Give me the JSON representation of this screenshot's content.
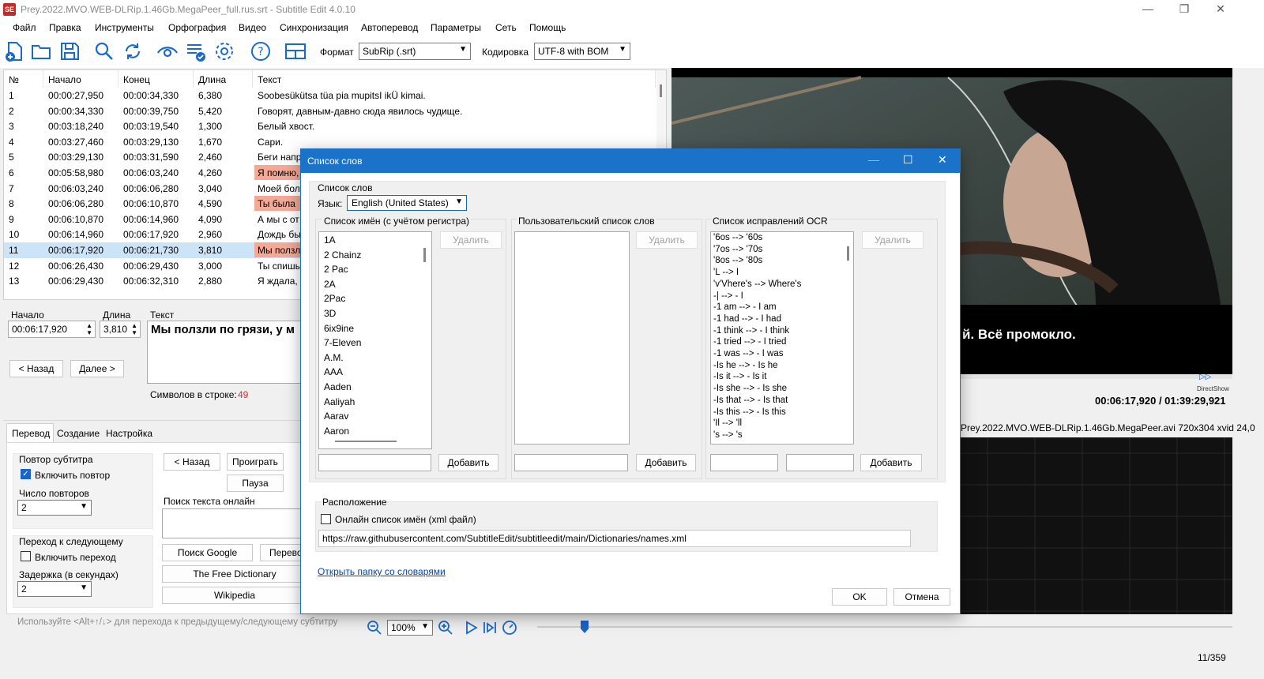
{
  "window": {
    "title": "Prey.2022.MVO.WEB-DLRip.1.46Gb.MegaPeer_full.rus.srt - Subtitle Edit 4.0.10",
    "app_icon": "SE"
  },
  "menu": [
    "Файл",
    "Правка",
    "Инструменты",
    "Орфография",
    "Видео",
    "Синхронизация",
    "Автоперевод",
    "Параметры",
    "Сеть",
    "Помощь"
  ],
  "toolbar": {
    "format_label": "Формат",
    "format_value": "SubRip (.srt)",
    "encoding_label": "Кодировка",
    "encoding_value": "UTF-8 with BOM",
    "icons": [
      "new-file-icon",
      "open-folder-icon",
      "save-icon",
      "find-icon",
      "replace-icon",
      "visual-sync-icon",
      "spell-check-icon",
      "settings-icon",
      "help-icon",
      "layout-icon"
    ]
  },
  "grid": {
    "headers": [
      "№",
      "Начало",
      "Конец",
      "Длина",
      "Текст"
    ],
    "rows": [
      {
        "n": "1",
        "start": "00:00:27,950",
        "end": "00:00:34,330",
        "dur": "6,380",
        "text": "Soobesükütsa tüa pia mupitsI ikÜ kimai."
      },
      {
        "n": "2",
        "start": "00:00:34,330",
        "end": "00:00:39,750",
        "dur": "5,420",
        "text": "Говорят, давным-давно сюда явилось чудище."
      },
      {
        "n": "3",
        "start": "00:03:18,240",
        "end": "00:03:19,540",
        "dur": "1,300",
        "text": "Белый хвост."
      },
      {
        "n": "4",
        "start": "00:03:27,460",
        "end": "00:03:29,130",
        "dur": "1,670",
        "text": "Сари."
      },
      {
        "n": "5",
        "start": "00:03:29,130",
        "end": "00:03:31,590",
        "dur": "2,460",
        "text": "Беги напр"
      },
      {
        "n": "6",
        "start": "00:05:58,980",
        "end": "00:06:03,240",
        "dur": "4,260",
        "text": "Я помню,"
      },
      {
        "n": "7",
        "start": "00:06:03,240",
        "end": "00:06:06,280",
        "dur": "3,040",
        "text": "Моей бол"
      },
      {
        "n": "8",
        "start": "00:06:06,280",
        "end": "00:06:10,870",
        "dur": "4,590",
        "text": "Ты была"
      },
      {
        "n": "9",
        "start": "00:06:10,870",
        "end": "00:06:14,960",
        "dur": "4,090",
        "text": "А мы с от"
      },
      {
        "n": "10",
        "start": "00:06:14,960",
        "end": "00:06:17,920",
        "dur": "2,960",
        "text": "Дождь бы"
      },
      {
        "n": "11",
        "start": "00:06:17,920",
        "end": "00:06:21,730",
        "dur": "3,810",
        "text": "Мы ползл"
      },
      {
        "n": "12",
        "start": "00:06:26,430",
        "end": "00:06:29,430",
        "dur": "3,000",
        "text": "Ты спишь"
      },
      {
        "n": "13",
        "start": "00:06:29,430",
        "end": "00:06:32,310",
        "dur": "2,880",
        "text": "Я ждала,"
      }
    ]
  },
  "edit": {
    "start_label": "Начало",
    "start_value": "00:06:17,920",
    "dur_label": "Длина",
    "dur_value": "3,810",
    "text_label": "Текст",
    "text_value": "Мы ползли по грязи, у м",
    "prev_button": "< Назад",
    "next_button": "Далее >",
    "chars_label": "Символов в строке:",
    "chars_value": "49"
  },
  "bottom_tabs": [
    "Перевод",
    "Создание",
    "Настройка"
  ],
  "translate": {
    "repeat_group": "Повтор субтитра",
    "repeat_check": "Включить повтор",
    "repeat_count_label": "Число повторов",
    "repeat_count_value": "2",
    "next_group": "Переход к следующему",
    "next_check": "Включить переход",
    "delay_label": "Задержка (в секундах)",
    "delay_value": "2",
    "back_button": "< Назад",
    "play_button": "Проиграть",
    "pause_button": "Пауза",
    "online_search_label": "Поиск текста онлайн",
    "google_button": "Поиск Google",
    "translate_button": "Перево",
    "free_dictionary_button": "The Free Dictionary",
    "wikipedia_button": "Wikipedia",
    "hint": "Используйте <Alt+↑/↓> для перехода к предыдущему/следующему субтитру"
  },
  "video": {
    "subtitle_overlay": "й. Всё промокло.",
    "time_display": "00:06:17,920 / 01:39:29,921",
    "renderer": "DirectShow",
    "file_info": "Prey.2022.MVO.WEB-DLRip.1.46Gb.MegaPeer.avi 720x304 xvid 24,0",
    "zoom_value": "100%"
  },
  "dialog": {
    "title": "Список слов",
    "section_label": "Список слов",
    "language_label": "Язык:",
    "language_value": "English (United States)",
    "names_group": "Список имён (с учётом регистра)",
    "names": [
      "1A",
      "2 Chainz",
      "2 Pac",
      "2A",
      "2Pac",
      "3D",
      "6ix9ine",
      "7-Eleven",
      "A.M.",
      "AAA",
      "Aaden",
      "Aaliyah",
      "Aarav",
      "Aaron"
    ],
    "user_group": "Пользовательский список слов",
    "ocr_group": "Список исправлений OCR",
    "ocr": [
      "'6os --> '60s",
      "'7os --> '70s",
      "'8os --> '80s",
      "'L  --> I",
      "'v'Vhere's --> Where's",
      "-| --> - I",
      "-1 am --> - I am",
      "-1 had --> - I had",
      "-1 think --> - I think",
      "-1 tried --> - I tried",
      "-1 was --> - I was",
      "-Is he --> - Is he",
      "-Is it --> - Is it",
      "-Is she --> - Is she",
      "-Is that --> - Is that",
      "-Is this --> - Is this",
      "'Il --> 'll",
      "'s --> 's"
    ],
    "remove_button": "Удалить",
    "add_button": "Добавить",
    "location_label": "Расположение",
    "online_names_check": "Онлайн список имён (xml файл)",
    "names_url": "https://raw.githubusercontent.com/SubtitleEdit/subtitleedit/main/Dictionaries/names.xml",
    "open_folder_link": "Открыть папку со словарями",
    "ok_button": "OK",
    "cancel_button": "Отмена"
  },
  "status": {
    "position": "11/359"
  },
  "colors": {
    "accent": "#1a73c9",
    "selection": "#cce4f7",
    "error_cell": "#f4a896",
    "chars_count": "#d32f2f"
  }
}
